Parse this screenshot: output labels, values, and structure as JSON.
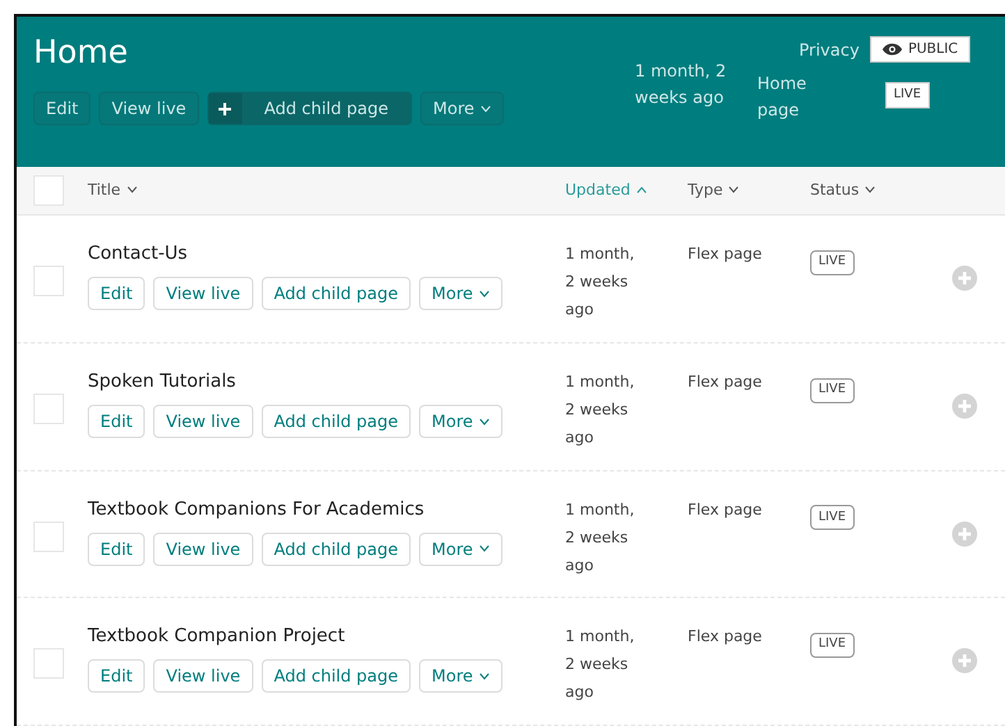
{
  "parent": {
    "title": "Home",
    "actions": [
      {
        "label": "Edit",
        "kind": "plain"
      },
      {
        "label": "View live",
        "kind": "plain"
      },
      {
        "label": "Add child page",
        "kind": "add"
      },
      {
        "label": "More",
        "kind": "menu"
      }
    ],
    "updated": "1 month, 2 weeks ago",
    "type": "Home page",
    "privacy_label": "Privacy",
    "privacy": "PUBLIC",
    "status": "LIVE"
  },
  "select_all": {
    "checked": false
  },
  "columns": [
    {
      "label": "Title",
      "selected": false
    },
    {
      "label": "Updated",
      "selected": true
    },
    {
      "label": "Type",
      "selected": false
    },
    {
      "label": "Status",
      "selected": false
    }
  ],
  "rows": [
    {
      "checked": false,
      "title": "Contact-Us",
      "actions": [
        {
          "label": "Edit",
          "kind": "plain"
        },
        {
          "label": "View live",
          "kind": "plain"
        },
        {
          "label": "Add child page",
          "kind": "plain"
        },
        {
          "label": "More",
          "kind": "menu"
        }
      ],
      "updated": "1 month, 2 weeks ago",
      "type": "Flex page",
      "status": "LIVE"
    },
    {
      "checked": false,
      "title": "Spoken Tutorials",
      "actions": [
        {
          "label": "Edit",
          "kind": "plain"
        },
        {
          "label": "View live",
          "kind": "plain"
        },
        {
          "label": "Add child page",
          "kind": "plain"
        },
        {
          "label": "More",
          "kind": "menu"
        }
      ],
      "updated": "1 month, 2 weeks ago",
      "type": "Flex page",
      "status": "LIVE"
    },
    {
      "checked": false,
      "title": "Textbook Companions For Academics",
      "actions": [
        {
          "label": "Edit",
          "kind": "plain"
        },
        {
          "label": "View live",
          "kind": "plain"
        },
        {
          "label": "Add child page",
          "kind": "plain"
        },
        {
          "label": "More",
          "kind": "menu"
        }
      ],
      "updated": "1 month, 2 weeks ago",
      "type": "Flex page",
      "status": "LIVE"
    },
    {
      "checked": false,
      "title": "Textbook Companion Project",
      "actions": [
        {
          "label": "Edit",
          "kind": "plain"
        },
        {
          "label": "View live",
          "kind": "plain"
        },
        {
          "label": "Add child page",
          "kind": "plain"
        },
        {
          "label": "More",
          "kind": "menu"
        }
      ],
      "updated": "1 month, 2 weeks ago",
      "type": "Flex page",
      "status": "LIVE"
    }
  ]
}
